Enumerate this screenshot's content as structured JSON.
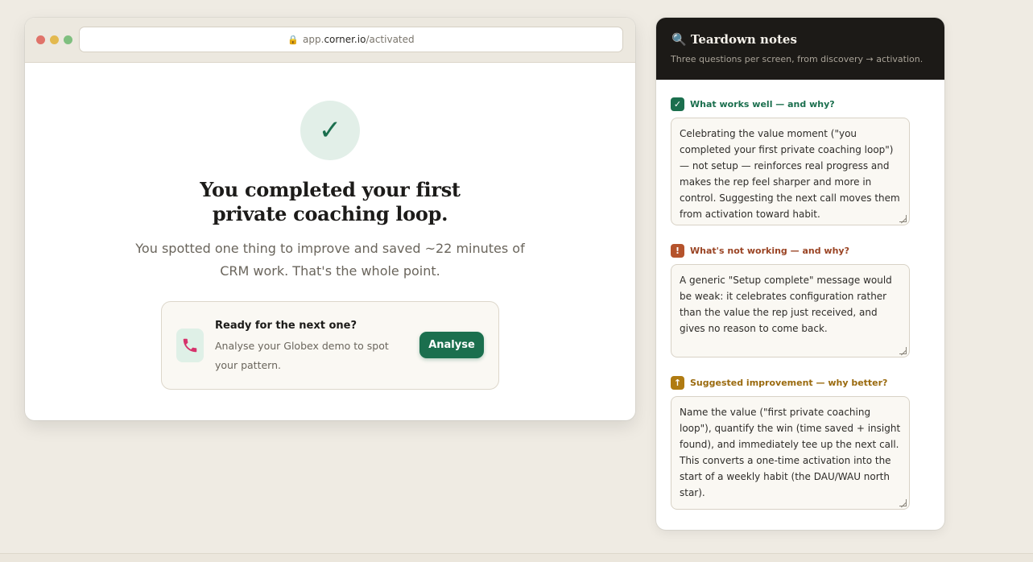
{
  "browser": {
    "url_prefix": "app.",
    "url_domain": "corner.io",
    "url_path": "/activated"
  },
  "success": {
    "headline_line1": "You completed your first",
    "headline_line2": "private coaching loop.",
    "subline": "You spotted one thing to improve and saved ~22 minutes of CRM work. That's the whole point."
  },
  "next_card": {
    "title": "Ready for the next one?",
    "description": "Analyse your Globex demo to spot your pattern.",
    "button_label": "Analyse"
  },
  "panel": {
    "icon": "🔍",
    "title": "Teardown notes",
    "subtitle": "Three questions per screen, from discovery → activation.",
    "sections": [
      {
        "badge": "✓",
        "label": "What works well — and why?",
        "color": "#1b6f4e",
        "note": "Celebrating the value moment (\"you completed your first private coaching loop\") — not setup — reinforces real progress and makes the rep feel sharper and more in control. Suggesting the next call moves them from activation toward habit."
      },
      {
        "badge": "!",
        "label": "What's not working — and why?",
        "color": "#b5532c",
        "note": "A generic \"Setup complete\" message would be weak: it celebrates configuration rather than the value the rep just received, and gives no reason to come back."
      },
      {
        "badge": "↑",
        "label": "Suggested improvement — why better?",
        "color": "#b07b12",
        "note": "Name the value (\"first private coaching loop\"), quantify the win (time saved + insight found), and immediately tee up the next call. This converts a one-time activation into the start of a weekly habit (the DAU/WAU north star)."
      }
    ]
  }
}
